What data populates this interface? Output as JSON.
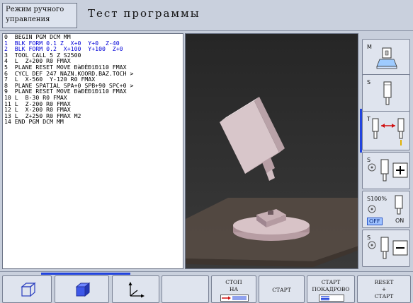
{
  "header": {
    "mode_line1": "Режим ручного",
    "mode_line2": "управления",
    "title": "Тест программы"
  },
  "program": {
    "lines": [
      "0  BEGIN PGM DCM MM",
      "1  BLK FORM 0.1 Z  X+0  Y+0  Z-40",
      "2  BLK FORM 0.2  X+100  Y+100  Z+0",
      "3  TOOL CALL 5 Z S2500",
      "4  L  Z+200 R0 FMAX",
      "5  PLANE RESET MOVE ÐàÐÈÐïÐï10 FMAX",
      "6  CYCL DEF 247 NAZN.KOORD.BAZ.TOCH >",
      "7  L  X-560  Y-120 R0 FMAX",
      "8  PLANE SPATIAL SPA+0 SPB+90 SPC+0 >",
      "9  PLANE RESET MOVE ÐàÐÈÐïÐï10 FMAX",
      "10 L  B-30 R0 FMAX",
      "11 L  Z-200 R0 FMAX",
      "12 L  X-200 R0 FMAX",
      "13 L  Z+250 R0 FMAX M2",
      "14 END PGM DCM MM"
    ]
  },
  "vsoft": {
    "m_label": "M",
    "s_label": "S",
    "t_label": "T",
    "s_plus_label": "S",
    "override_label": "S100%",
    "off_label": "OFF",
    "on_label": "ON",
    "s_minus_label": "S"
  },
  "hsoft": {
    "stop_line1": "СТОП",
    "stop_line2": "НА",
    "start_label": "СТАРТ",
    "start_block_line1": "СТАРТ",
    "start_block_line2": "ПОКАДРОВО",
    "reset_line1": "RESET",
    "reset_line2": "+",
    "reset_line3": "СТАРТ"
  },
  "colors": {
    "accent": "#2244dd",
    "active_line": "#0000d8",
    "cursor_bg": "#0a0a0a"
  }
}
